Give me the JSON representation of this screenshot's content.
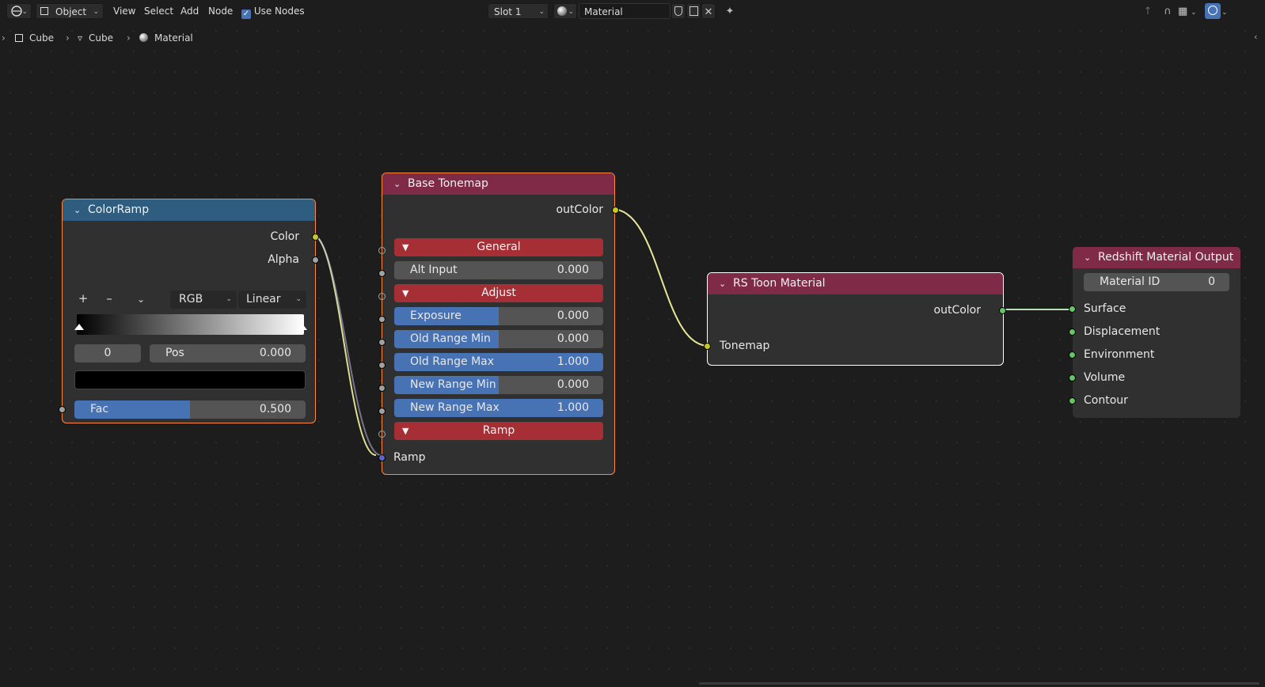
{
  "header": {
    "mode": "Object",
    "menus": [
      "View",
      "Select",
      "Add",
      "Node"
    ],
    "use_nodes_label": "Use Nodes",
    "use_nodes_checked": true,
    "slot": "Slot 1",
    "material_name": "Material"
  },
  "breadcrumb": [
    "Cube",
    "Cube",
    "Material"
  ],
  "nodes": {
    "colorramp": {
      "title": "ColorRamp",
      "outputs": [
        "Color",
        "Alpha"
      ],
      "color_mode": "RGB",
      "interpolation": "Linear",
      "stop_index": "0",
      "pos_label": "Pos",
      "pos_value": "0.000",
      "fac_label": "Fac",
      "fac_value": "0.500",
      "fac_fraction": 0.5
    },
    "tonemap": {
      "title": "Base Tonemap",
      "output": "outColor",
      "panel_general": "General",
      "alt_input_label": "Alt Input",
      "alt_input_value": "0.000",
      "panel_adjust": "Adjust",
      "fields": [
        {
          "label": "Exposure",
          "value": "0.000",
          "fraction": 0.5
        },
        {
          "label": "Old Range Min",
          "value": "0.000",
          "fraction": 0.5
        },
        {
          "label": "Old Range Max",
          "value": "1.000",
          "fraction": 1.0
        },
        {
          "label": "New Range Min",
          "value": "0.000",
          "fraction": 0.5
        },
        {
          "label": "New Range Max",
          "value": "1.000",
          "fraction": 1.0
        }
      ],
      "panel_ramp": "Ramp",
      "ramp_input": "Ramp"
    },
    "toon": {
      "title": "RS Toon Material",
      "output": "outColor",
      "input": "Tonemap"
    },
    "output": {
      "title": "Redshift Material Output",
      "material_id_label": "Material ID",
      "material_id_value": "0",
      "inputs": [
        "Surface",
        "Displacement",
        "Environment",
        "Volume",
        "Contour"
      ]
    }
  },
  "colors": {
    "colorramp_header": "#2e5d80",
    "shader_header": "#7f2a47",
    "selected_outline": "#ff8a3d",
    "socket_color": "#c7c729",
    "socket_shader": "#63c763",
    "field_fill": "#4772b3",
    "panel_red": "#a52f35"
  }
}
